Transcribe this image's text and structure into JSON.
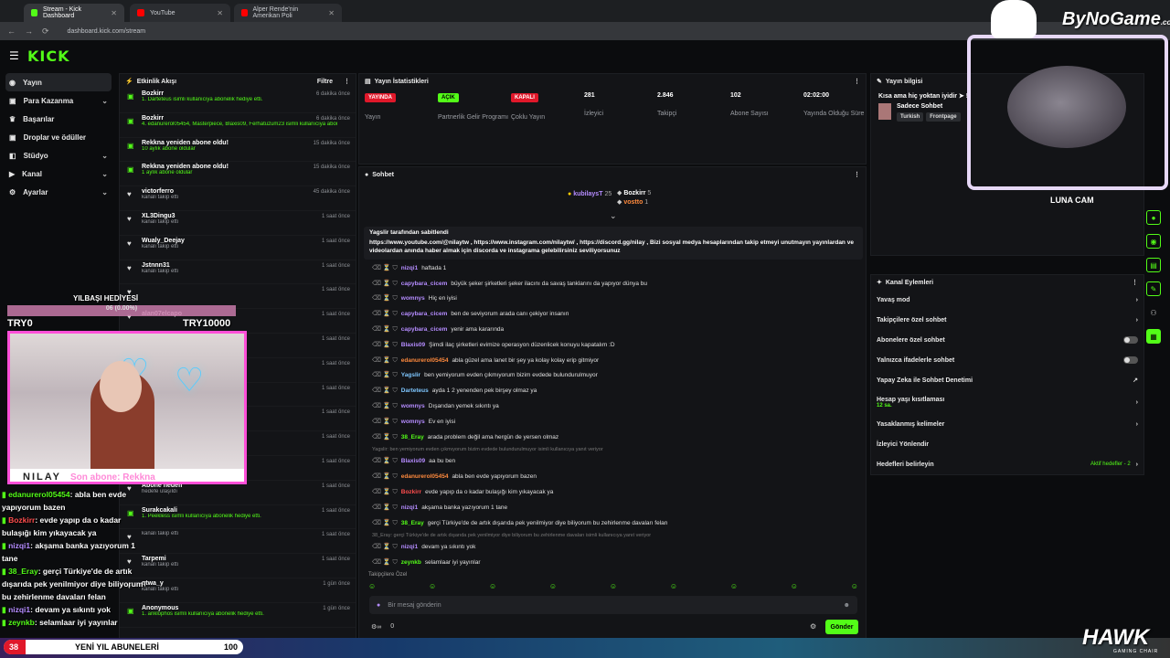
{
  "browser": {
    "tabs": [
      {
        "label": "Stream - Kick Dashboard",
        "active": true,
        "color": "#53fc18"
      },
      {
        "label": "YouTube",
        "active": false,
        "color": "#ff0000"
      },
      {
        "label": "Alper Rende'nin Amerikan Poli",
        "active": false,
        "color": "#ff0000"
      }
    ],
    "url": "dashboard.kick.com/stream"
  },
  "header": {
    "logo": "KICK"
  },
  "sidebar": {
    "items": [
      {
        "label": "Yayın",
        "icon": "broadcast-icon",
        "active": true,
        "expandable": false
      },
      {
        "label": "Para Kazanma",
        "icon": "money-icon",
        "expandable": true
      },
      {
        "label": "Başarılar",
        "icon": "trophy-icon",
        "expandable": false
      },
      {
        "label": "Droplar ve ödüller",
        "icon": "gift-icon",
        "expandable": false
      },
      {
        "label": "Stüdyo",
        "icon": "studio-icon",
        "expandable": true
      },
      {
        "label": "Kanal",
        "icon": "channel-icon",
        "expandable": true
      },
      {
        "label": "Ayarlar",
        "icon": "gear-icon",
        "expandable": true
      }
    ]
  },
  "activity": {
    "title": "Etkinlik Akışı",
    "filter": "Filtre",
    "items": [
      {
        "name": "Bozkirr",
        "sub": "1. Darteteus isimli kullanıcıya abonelik hediye etti.",
        "time": "6 dakika önce",
        "green": true
      },
      {
        "name": "Bozkirr",
        "sub": "4. edanurerol05454, Masterpiece, Blaxis09, Ferhatuzum23 isimli kullanıcıya abonelik hediye etti.",
        "time": "6 dakika önce",
        "green": true
      },
      {
        "name": "Rekkna yeniden abone oldu!",
        "sub": "10 aylık abone oldular",
        "time": "15 dakika önce",
        "green": true
      },
      {
        "name": "Rekkna yeniden abone oldu!",
        "sub": "1 aylık abone oldular",
        "time": "15 dakika önce",
        "green": true
      },
      {
        "name": "victorferro",
        "sub": "kanalı takip etti",
        "time": "45 dakika önce",
        "green": false
      },
      {
        "name": "XL3Dingu3",
        "sub": "kanalı takip etti",
        "time": "1 saat önce",
        "green": false
      },
      {
        "name": "Wualy_Deejay",
        "sub": "kanalı takip etti",
        "time": "1 saat önce",
        "green": false
      },
      {
        "name": "Jstnnn31",
        "sub": "kanalı takip etti",
        "time": "1 saat önce",
        "green": false
      },
      {
        "name": "",
        "sub": "",
        "time": "1 saat önce",
        "green": false
      },
      {
        "name": "alan07elcapo",
        "sub": "",
        "time": "1 saat önce",
        "green": false
      },
      {
        "name": "",
        "sub": "",
        "time": "1 saat önce",
        "green": false
      },
      {
        "name": "",
        "sub": "",
        "time": "1 saat önce",
        "green": false
      },
      {
        "name": "",
        "sub": "",
        "time": "1 saat önce",
        "green": false
      },
      {
        "name": "",
        "sub": "",
        "time": "1 saat önce",
        "green": false
      },
      {
        "name": "",
        "sub": "",
        "time": "1 saat önce",
        "green": false
      },
      {
        "name": "",
        "sub": "",
        "time": "1 saat önce",
        "green": false
      },
      {
        "name": "Abone hedefi",
        "sub": "hedefe ulaşıldı",
        "time": "1 saat önce",
        "green": false
      },
      {
        "name": "Surakcakali",
        "sub": "1. Peekless isimli kullanıcıya abonelik hediye etti.",
        "time": "1 saat önce",
        "green": true
      },
      {
        "name": "",
        "sub": "kanalı takip etti",
        "time": "1 saat önce",
        "green": false
      },
      {
        "name": "Tarpemi",
        "sub": "kanalı takip etti",
        "time": "1 saat önce",
        "green": false
      },
      {
        "name": "qtwa_y",
        "sub": "kanalı takip etti",
        "time": "1 gün önce",
        "green": false
      },
      {
        "name": "Anonymous",
        "sub": "1. anklophos isimli kullanıcıya abonelik hediye etti.",
        "time": "1 gün önce",
        "green": true
      }
    ]
  },
  "stats": {
    "title": "Yayın İstatistikleri",
    "items": [
      {
        "value": "YAYINDA",
        "label": "Yayın",
        "badge": true,
        "color": "#e0182a"
      },
      {
        "value": "AÇIK",
        "label": "Partnerlik Gelir Programı",
        "badge": true,
        "color": "#53fc18"
      },
      {
        "value": "KAPALI",
        "label": "Çoklu Yayın",
        "badge": true,
        "color": "#e0182a"
      },
      {
        "value": "281",
        "label": "İzleyici",
        "badge": false
      },
      {
        "value": "2.846",
        "label": "Takipçi",
        "badge": false
      },
      {
        "value": "102",
        "label": "Abone Sayısı",
        "badge": false
      },
      {
        "value": "02:02:00",
        "label": "Yayında Olduğu Süre",
        "badge": false
      }
    ]
  },
  "chat": {
    "title": "Sohbet",
    "leaderboard": [
      {
        "name": "kubilaysT",
        "count": "25"
      },
      {
        "name": "Bozkirr",
        "count": "5"
      },
      {
        "name": "vostto",
        "count": "1"
      }
    ],
    "pinned_by": "Yagslir tarafından sabitlendi",
    "pinned_text": "https://www.youtube.com/@nilaytw , https://www.instagram.com/nilaytw/ , https://discord.gg/nilay , Bizi sosyal medya hesaplarından takip etmeyi unutmayın yayınlardan ve videolardan anında haber almak için discorda ve instagrama gelebilirsiniz seviliyorsunuz",
    "messages": [
      {
        "user": "nizqi1",
        "text": "haftada 1",
        "color": "#b58cff"
      },
      {
        "user": "capybara_cicem",
        "text": "büyük şeker şirketleri şeker ilacını da savaş tanklarını da yapıyor dünya bu",
        "color": "#b58cff"
      },
      {
        "user": "womnys",
        "text": "Hiç en iyisi",
        "color": "#b58cff"
      },
      {
        "user": "capybara_cicem",
        "text": "ben de seviyorum arada canı çekiyor insanın",
        "color": "#b58cff"
      },
      {
        "user": "capybara_cicem",
        "text": "yenir ama kararında",
        "color": "#b58cff"
      },
      {
        "user": "Blaxis09",
        "text": "Şimdi ilaç şirketleri evimize operasyon düzenlicek konuyu kapatalım :D",
        "color": "#b58cff"
      },
      {
        "user": "edanurerol05454",
        "text": "abla güzel ama lanet bir şey ya kolay kolay erip gitmiyor",
        "color": "#ff8a3d"
      },
      {
        "user": "Yagslir",
        "text": "ben yemiyorum evden çıkmıyorum bizim evdede bulundurulmuyor",
        "color": "#7fc7ff"
      },
      {
        "user": "Darteteus",
        "text": "ayda 1 2 yenenden pek birşey olmaz ya",
        "color": "#7fc7ff"
      },
      {
        "user": "womnys",
        "text": "Dışarıdan yemek sıkıntı ya",
        "color": "#b58cff"
      },
      {
        "user": "womnys",
        "text": "Ev en iyisi",
        "color": "#b58cff"
      },
      {
        "user": "38_Eray",
        "text": "arada problem değil ama hergün de yersen olmaz",
        "color": "#53fc18"
      },
      {
        "user": "Blaxis09",
        "text": "aa bu ben",
        "color": "#b58cff",
        "reply": "Yagslir: ben yemiyorum evden çıkmıyorum bizim evdede bulundurulmuyor isimli kullanıcıya yanıt veriyor"
      },
      {
        "user": "edanurerol05454",
        "text": "abla ben evde yapıyorum bazen",
        "color": "#ff8a3d"
      },
      {
        "user": "Bozkirr",
        "text": "evde yapıp da o kadar bulaşığı kim yıkayacak ya",
        "color": "#ff4d4d"
      },
      {
        "user": "nizqi1",
        "text": "akşama banka yazıyorum 1 tane",
        "color": "#b58cff"
      },
      {
        "user": "38_Eray",
        "text": "gerçi Türkiye'de de artık dışarıda pek yenilmiyor diye biliyorum bu zehirlenme davaları felan",
        "color": "#53fc18"
      },
      {
        "user": "nizqi1",
        "text": "devam ya sıkıntı yok",
        "color": "#b58cff",
        "reply": "38_Eray: gerçi Türkiye'de de artık dışarıda pek yenilmiyor diye biliyorum bu zehirlenme davaları isimli kullanıcıya yanıt veriyor"
      },
      {
        "user": "zeynkb",
        "text": "selamlaar iyi yayınlar",
        "color": "#53fc18"
      }
    ],
    "followers_only": "Takipçilere Özel",
    "input_placeholder": "Bir mesaj gönderin",
    "send": "Gönder",
    "count": "0"
  },
  "streaminfo": {
    "title": "Yayın bilgisi",
    "stream_title": "Kısa ama hiç yoktan iyidir ➤ !",
    "category": "Sadece Sohbet",
    "tags": [
      "Turkish",
      "Frontpage"
    ]
  },
  "channel_actions": {
    "title": "Kanal Eylemleri",
    "items": [
      {
        "label": "Yavaş mod",
        "control": "chevron"
      },
      {
        "label": "Takipçilere özel sohbet",
        "control": "chevron"
      },
      {
        "label": "Abonelere özel sohbet",
        "control": "toggle"
      },
      {
        "label": "Yalnızca ifadelerle sohbet",
        "control": "toggle"
      },
      {
        "label": "Yapay Zeka ile Sohbet Denetimi",
        "control": "external"
      },
      {
        "label": "Hesap yaşı kısıtlaması",
        "sub": "12 sa.",
        "control": "chevron"
      },
      {
        "label": "Yasaklanmış kelimeler",
        "control": "chevron"
      },
      {
        "label": "İzleyici Yönlendir",
        "control": "none"
      },
      {
        "label": "Hedefleri belirleyin",
        "extra": "Aktif hedefler - 2",
        "control": "chevron"
      }
    ]
  },
  "overlay": {
    "gift_title": "YILBAŞI HEDİYESİ",
    "gift_progress": "06 (0.00%)",
    "gift_progress_value": 0,
    "try_left": "TRY0",
    "try_right": "TRY10000",
    "name": "NILAY",
    "last_sub": "Son abone: Rekkna",
    "cam_label": "LUNA CAM",
    "brand": "ByNoGame",
    "brand_sub": ".com",
    "hawk": "HAWK",
    "hawk_sub": "GAMING CHAIR",
    "subs_left": "38",
    "subs_label": "YENİ YIL ABUNELERİ",
    "subs_right": "100",
    "chat_lines": [
      {
        "user": "edanurerol05454",
        "text": ": abla ben evde yapıyorum bazen",
        "color": "#53fc18"
      },
      {
        "user": "Bozkirr",
        "text": ": evde yapıp da o kadar bulaşığı kim yıkayacak ya",
        "color": "#ff4d4d"
      },
      {
        "user": "nizqi1",
        "text": ": akşama banka yazıyorum 1 tane",
        "color": "#b58cff"
      },
      {
        "user": "38_Eray",
        "text": ": gerçi Türkiye'de de artık dışarıda pek yenilmiyor diye biliyorum bu zehirlenme davaları felan",
        "color": "#53fc18"
      },
      {
        "user": "nizqi1",
        "text": ": devam ya sıkıntı yok",
        "color": "#b58cff"
      },
      {
        "user": "zeynkb",
        "text": ": selamlaar iyi yayınlar",
        "color": "#53fc18"
      }
    ]
  }
}
